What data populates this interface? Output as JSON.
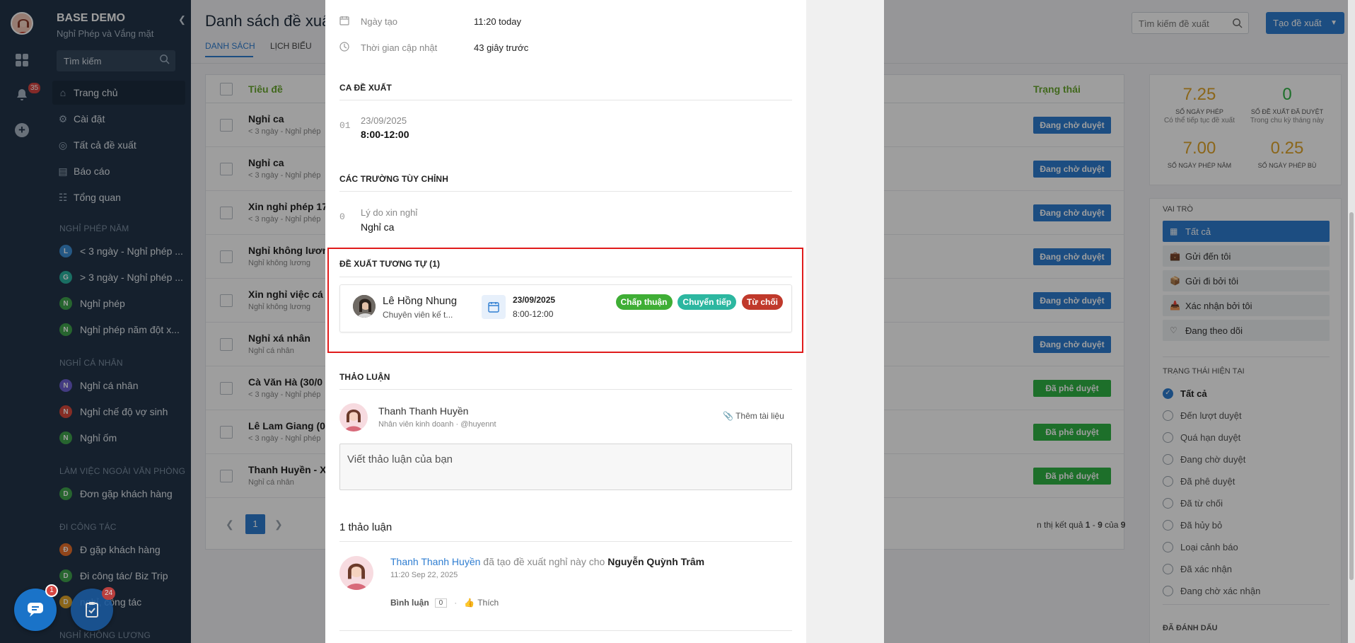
{
  "app": {
    "name": "BASE DEMO",
    "subtitle": "Nghỉ Phép và Vắng mặt",
    "search_placeholder": "Tìm kiếm",
    "notif_count": "35",
    "chat_badge": "1",
    "task_badge": "24"
  },
  "nav": {
    "main_items": [
      {
        "label": "Trang chủ",
        "icon": "home-icon"
      },
      {
        "label": "Cài đặt",
        "icon": "gear-icon"
      },
      {
        "label": "Tất cả đề xuất",
        "icon": "target-icon"
      },
      {
        "label": "Báo cáo",
        "icon": "chart-icon"
      },
      {
        "label": "Tổng quan",
        "icon": "overview-icon"
      }
    ],
    "sections": [
      {
        "title": "NGHỈ PHÉP NĂM",
        "items": [
          {
            "letter": "L",
            "label": "< 3 ngày - Nghỉ phép ...",
            "color": "#3d8fd6"
          },
          {
            "letter": "G",
            "label": "> 3 ngày - Nghỉ phép ...",
            "color": "#2bb3a0"
          },
          {
            "letter": "N",
            "label": "Nghỉ phép",
            "color": "#3fa34d"
          },
          {
            "letter": "N",
            "label": "Nghỉ phép năm đột x...",
            "color": "#3fa34d"
          }
        ]
      },
      {
        "title": "NGHỈ CÁ NHÂN",
        "items": [
          {
            "letter": "N",
            "label": "Nghỉ cá nhân",
            "color": "#6d5fd1"
          },
          {
            "letter": "N",
            "label": "Nghỉ chế độ vợ sinh",
            "color": "#d94a3d"
          },
          {
            "letter": "N",
            "label": "Nghỉ ốm",
            "color": "#3fa34d"
          }
        ]
      },
      {
        "title": "LÀM VIỆC NGOÀI VĂN PHÒNG",
        "items": [
          {
            "letter": "D",
            "label": "Đơn gặp khách hàng",
            "color": "#3fa34d"
          }
        ]
      },
      {
        "title": "ĐI CÔNG TÁC",
        "items": [
          {
            "letter": "Đ",
            "label": "Đ gặp khách hàng",
            "color": "#e8702a"
          },
          {
            "letter": "D",
            "label": "Đi công tác/ Biz Trip",
            "color": "#3fa34d"
          },
          {
            "letter": "D",
            "label": "nghỉ, công tác",
            "color": "#e0a52a"
          }
        ]
      },
      {
        "title": "NGHỈ KHÔNG LƯƠNG",
        "items": []
      }
    ]
  },
  "page": {
    "title": "Danh sách đề xuất",
    "tabs": [
      "DANH SÁCH",
      "LỊCH BIỂU"
    ],
    "search_placeholder": "Tìm kiếm đề xuất",
    "create_label": "Tạo đề xuất"
  },
  "table": {
    "col_title": "Tiêu đề",
    "col_status": "Trạng thái",
    "rows": [
      {
        "title": "Nghỉ ca",
        "sub": "< 3 ngày - Nghỉ phép",
        "status": "Đang chờ duyệt",
        "status_color": "#2e7dd1"
      },
      {
        "title": "Nghỉ ca",
        "sub": "< 3 ngày - Nghỉ phép",
        "status": "Đang chờ duyệt",
        "status_color": "#2e7dd1"
      },
      {
        "title": "Xin nghỉ phép 17",
        "sub": "< 3 ngày - Nghỉ phép",
        "status": "Đang chờ duyệt",
        "status_color": "#2e7dd1"
      },
      {
        "title": "Nghỉ không lươn",
        "sub": "Nghỉ không lương",
        "status": "Đang chờ duyệt",
        "status_color": "#2e7dd1"
      },
      {
        "title": "Xin nghỉ việc cá",
        "sub": "Nghỉ không lương",
        "status": "Đang chờ duyệt",
        "status_color": "#2e7dd1"
      },
      {
        "title": "Nghỉ xá nhân",
        "sub": "Nghỉ cá nhân",
        "status": "Đang chờ duyệt",
        "status_color": "#2e7dd1"
      },
      {
        "title": "Cà Văn Hà (30/0",
        "sub": "< 3 ngày - Nghỉ phép",
        "status": "Đã phê duyệt",
        "status_color": "#2fb344"
      },
      {
        "title": "Lê Lam Giang (0",
        "sub": "< 3 ngày - Nghỉ phép",
        "status": "Đã phê duyệt",
        "status_color": "#2fb344"
      },
      {
        "title": "Thanh Huyền - X",
        "sub": "Nghỉ cá nhân",
        "status": "Đã phê duyệt",
        "status_color": "#2fb344"
      }
    ],
    "page_num": "1",
    "result_prefix": "n thị kết quả ",
    "result_range": "1",
    "result_dash": " - ",
    "result_end": "9",
    "result_of": " của ",
    "result_total": "9"
  },
  "stats": [
    {
      "value": "7.25",
      "label": "SỐ NGÀY PHÉP",
      "sub": "Có thể tiếp tục đề xuất",
      "color": "#e0a52a"
    },
    {
      "value": "0",
      "label": "SỐ ĐỀ XUẤT ĐÃ DUYỆT",
      "sub": "Trong chu kỳ tháng này",
      "color": "#2fb344"
    },
    {
      "value": "7.00",
      "label": "SỐ NGÀY PHÉP NĂM",
      "sub": "",
      "color": "#e0a52a"
    },
    {
      "value": "0.25",
      "label": "SỐ NGÀY PHÉP BÙ",
      "sub": "",
      "color": "#e0a52a"
    }
  ],
  "roles": {
    "title": "VAI TRÒ",
    "items": [
      {
        "label": "Tất cả",
        "icon": "grid-icon",
        "active": true
      },
      {
        "label": "Gửi đến tôi",
        "icon": "briefcase-icon"
      },
      {
        "label": "Gửi đi bởi tôi",
        "icon": "box-icon"
      },
      {
        "label": "Xác nhận bởi tôi",
        "icon": "inbox-icon"
      },
      {
        "label": "Đang theo dõi",
        "icon": "heart-icon"
      }
    ]
  },
  "status_filter": {
    "title": "TRẠNG THÁI HIỆN TẠI",
    "items": [
      "Tất cả",
      "Đến lượt duyệt",
      "Quá hạn duyệt",
      "Đang chờ duyệt",
      "Đã phê duyệt",
      "Đã từ chối",
      "Đã hủy bỏ",
      "Loại cảnh báo",
      "Đã xác nhận",
      "Đang chờ xác nhận"
    ]
  },
  "marked_title": "ĐÃ ĐÁNH DẤU",
  "modal": {
    "created_label": "Ngày tạo",
    "created_value": "11:20 today",
    "updated_label": "Thời gian cập nhật",
    "updated_value": "43 giây trước",
    "shift_title": "CA ĐỀ XUẤT",
    "shift_index": "01",
    "shift_date": "23/09/2025",
    "shift_time": "8:00-12:00",
    "custom_title": "CÁC TRƯỜNG TÙY CHỈNH",
    "custom_index": "0",
    "custom_label": "Lý do xin nghỉ",
    "custom_value": "Nghỉ ca",
    "similar_title": "ĐỀ XUẤT TƯƠNG TỰ (1)",
    "similar": {
      "name": "Lê Hồng Nhung",
      "role": "Chuyên viên kế t...",
      "date": "23/09/2025",
      "time": "8:00-12:00",
      "approve": "Chấp thuận",
      "forward": "Chuyển tiếp",
      "reject": "Từ chối"
    },
    "discussion_title": "THẢO LUẬN",
    "user_name": "Thanh Thanh Huyền",
    "user_role": "Nhân viên kinh doanh · @huyennt",
    "attach_label": "Thêm tài liệu",
    "comment_placeholder": "Viết thảo luận của bạn",
    "count_label": "1 thảo luận",
    "activity": {
      "actor": "Thanh Thanh Huyền",
      "action": " đã tạo đề xuất nghỉ này cho ",
      "target": "Nguyễn Quỳnh Trâm",
      "time": "11:20 Sep 22, 2025",
      "comment_label": "Bình luận",
      "comment_count": "0",
      "like_label": "Thích"
    }
  },
  "colors": {
    "sidebar": "#23354a",
    "accent": "#2e7dd1",
    "highlight": "#e01b1b"
  }
}
